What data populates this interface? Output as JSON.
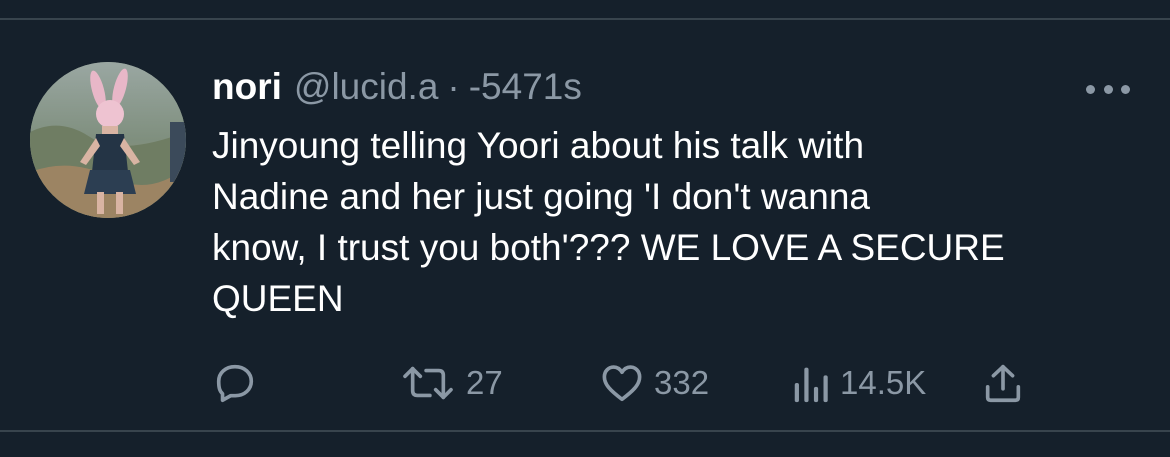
{
  "tweet": {
    "author_name": "nori",
    "handle": "@lucid.a",
    "separator": "·",
    "time": "-5471s",
    "text": "Jinyoung telling Yoori about his talk with\nNadine and her just going 'I don't wanna\nknow, I trust you both'??? WE LOVE A SECURE\nQUEEN"
  },
  "actions": {
    "reply": {
      "icon": "reply-icon",
      "count": ""
    },
    "retweet": {
      "icon": "retweet-icon",
      "count": "27"
    },
    "like": {
      "icon": "heart-icon",
      "count": "332"
    },
    "views": {
      "icon": "analytics-icon",
      "count": "14.5K"
    },
    "share": {
      "icon": "share-icon"
    }
  },
  "colors": {
    "background": "#15202b",
    "divider": "#38444d",
    "primary_text": "#ffffff",
    "secondary_text": "#8b98a5"
  }
}
